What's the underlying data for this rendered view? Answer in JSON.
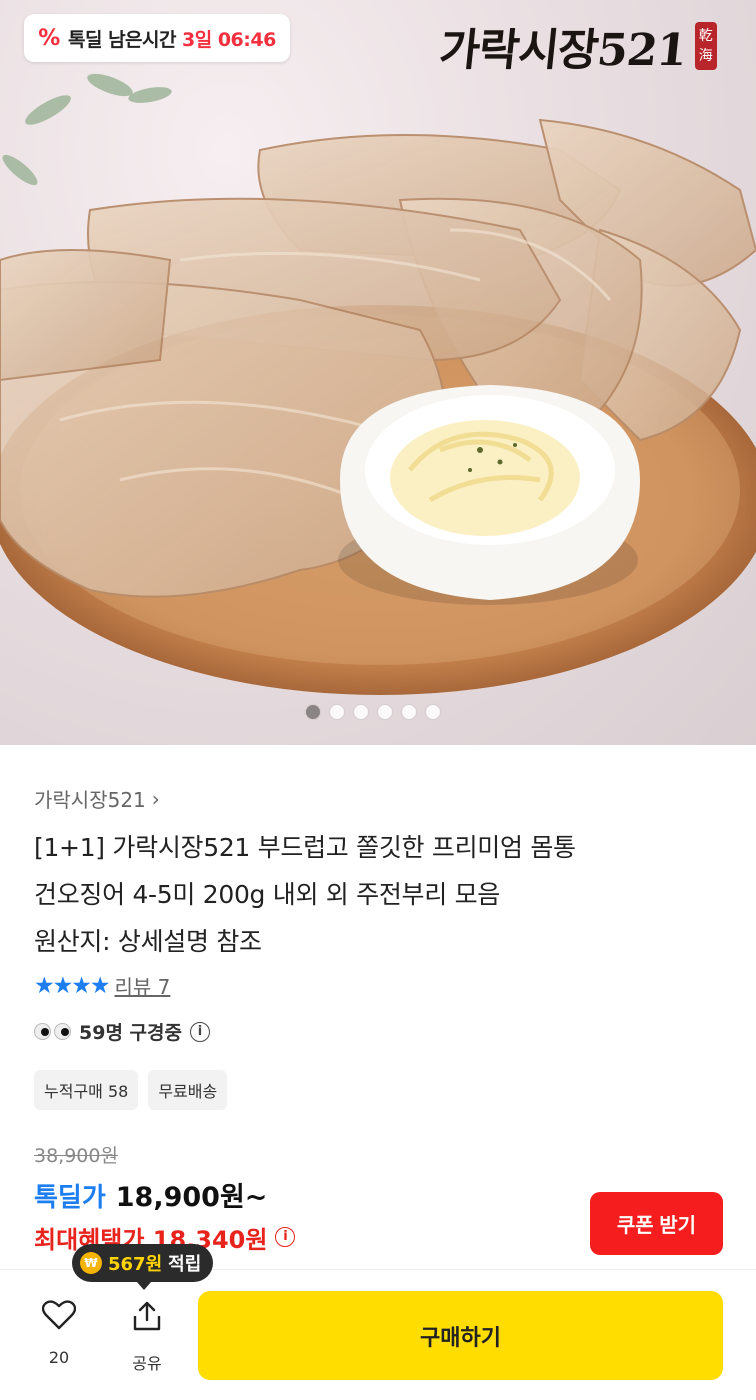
{
  "hero": {
    "timer_label": "톡딜 남은시간",
    "timer_value": "3일 06:46",
    "brand_logo_text": "가락시장521",
    "brand_seal_text": "乾海",
    "image_desc_icon": "dried-squid-photo",
    "slide_count": 6,
    "active_slide": 1
  },
  "product": {
    "seller": "가락시장521",
    "title_lines": [
      "[1+1] 가락시장521 부드럽고 쫄깃한 프리미엄 몸통",
      "건오징어 4-5미 200g 내외 외 주전부리 모음",
      "원산지: 상세설명 참조"
    ],
    "rating_stars": 4,
    "review_label": "리뷰 7",
    "viewers_text": "59명 구경중",
    "tags": [
      "누적구매 58",
      "무료배송"
    ]
  },
  "price": {
    "original": "38,900원",
    "sale_label": "톡딜가",
    "sale_price": "18,900원~",
    "max_benefit": "최대혜택가 18,340원",
    "coupon_button": "쿠폰 받기"
  },
  "bottom": {
    "points_amount": "567원",
    "points_label": "적립",
    "like_count": "20",
    "share_label": "공유",
    "buy_button": "구매하기"
  },
  "colors": {
    "accent_red": "#f51d1d",
    "accent_blue": "#1c7ef0",
    "buy_yellow": "#ffdd00"
  }
}
